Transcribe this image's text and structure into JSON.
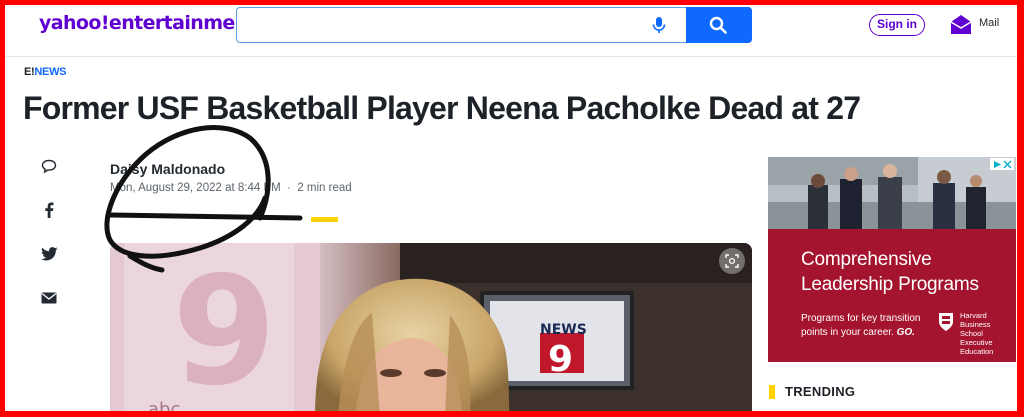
{
  "header": {
    "logo": "yahoo!entertainment",
    "search": {
      "value": "",
      "placeholder": ""
    },
    "signin_label": "Sign in",
    "mail_label": "Mail"
  },
  "article": {
    "source_prefix": "E!",
    "source_name": "NEWS",
    "title": "Former USF Basketball Player Neena Pacholke Dead at 27",
    "author": "Daisy Maldonado",
    "date": "Mon, August 29, 2022 at 8:44 PM",
    "separator": "·",
    "read_time": "2 min read",
    "image": {
      "sign_top": "NEWS",
      "sign_num": "9",
      "letters": "abc 9",
      "letters_small": "abc"
    }
  },
  "share": {
    "items": [
      {
        "name": "comment",
        "icon": "comment-icon"
      },
      {
        "name": "facebook",
        "icon": "facebook-icon"
      },
      {
        "name": "twitter",
        "icon": "twitter-icon"
      },
      {
        "name": "email",
        "icon": "mail-icon"
      }
    ]
  },
  "ad": {
    "headline_1": "Comprehensive",
    "headline_2": "Leadership Programs",
    "body_1": "Programs for key transition",
    "body_2": "points in your career.",
    "body_cta": "GO.",
    "brand_1": "Harvard",
    "brand_2": "Business",
    "brand_3": "School",
    "brand_4": "Executive",
    "brand_5": "Education",
    "colors": {
      "background": "#a5142f"
    }
  },
  "sidebar": {
    "trending_label": "TRENDING"
  },
  "colors": {
    "brand": "#6001d2",
    "search_button": "#0f69ff",
    "accent": "#ffd200",
    "frame": "#ff0000"
  }
}
